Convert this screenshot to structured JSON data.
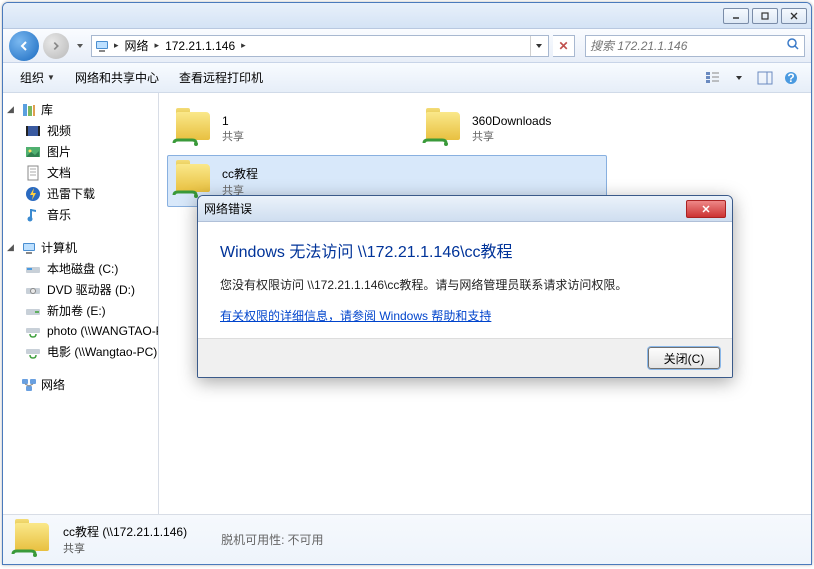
{
  "address": {
    "seg1": "网络",
    "seg2": "172.21.1.146"
  },
  "search": {
    "placeholder": "搜索 172.21.1.146"
  },
  "toolbar": {
    "organize": "组织",
    "nsc": "网络和共享中心",
    "remote_print": "查看远程打印机"
  },
  "sidebar": {
    "library": {
      "label": "库",
      "items": [
        "视频",
        "图片",
        "文档",
        "迅雷下载",
        "音乐"
      ]
    },
    "computer": {
      "label": "计算机",
      "items": [
        "本地磁盘 (C:)",
        "DVD 驱动器 (D:)",
        "新加卷 (E:)",
        "photo (\\\\WANGTAO-PC)",
        "电影 (\\\\Wangtao-PC)"
      ]
    },
    "network": {
      "label": "网络"
    }
  },
  "folders": [
    {
      "name": "1",
      "sub": "共享"
    },
    {
      "name": "360Downloads",
      "sub": "共享"
    },
    {
      "name": "cc教程",
      "sub": "共享"
    }
  ],
  "details": {
    "name": "cc教程 (\\\\172.21.1.146)",
    "sub": "共享",
    "prop_label": "脱机可用性:",
    "prop_value": "不可用"
  },
  "dialog": {
    "title": "网络错误",
    "heading": "Windows 无法访问 \\\\172.21.1.146\\cc教程",
    "message": "您没有权限访问 \\\\172.21.1.146\\cc教程。请与网络管理员联系请求访问权限。",
    "link": "有关权限的详细信息，请参阅 Windows 帮助和支持",
    "close_btn": "关闭(C)"
  }
}
